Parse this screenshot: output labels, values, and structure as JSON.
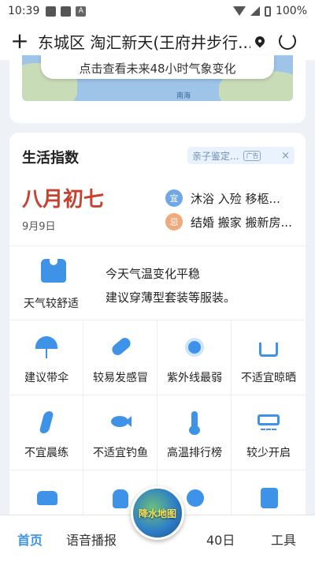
{
  "status_bar": {
    "time": "10:39",
    "notif_a": "A",
    "battery": "100%"
  },
  "header": {
    "location": "东城区 淘汇新天(王府井步行..."
  },
  "map": {
    "forecast_pill": "点击查看未来48小时气象变化",
    "sea_label": "南海"
  },
  "life_index": {
    "title": "生活指数",
    "ad": {
      "text": "亲子鉴定...",
      "tag": "广告",
      "close": "×"
    },
    "almanac": {
      "lunar_date": "八月初七",
      "solar_date": "9月9日",
      "yi_badge": "宜",
      "yi_items": "沐浴 入殓 移柩...",
      "ji_badge": "忌",
      "ji_items": "结婚 搬家 搬新房..."
    },
    "comfort": {
      "label": "天气较舒适",
      "advice_line1": "今天气温变化平稳",
      "advice_line2": "建议穿薄型套装等服装。"
    },
    "grid": [
      {
        "label": "建议带伞",
        "icon": "umbrella-icon"
      },
      {
        "label": "较易发感冒",
        "icon": "pill-icon"
      },
      {
        "label": "紫外线最弱",
        "icon": "sun-icon"
      },
      {
        "label": "不适宜晾晒",
        "icon": "hanger-icon"
      },
      {
        "label": "不宜晨练",
        "icon": "runner-icon"
      },
      {
        "label": "不适宜钓鱼",
        "icon": "fish-icon"
      },
      {
        "label": "高温排行榜",
        "icon": "thermometer-icon"
      },
      {
        "label": "较少开启",
        "icon": "air-conditioner-icon"
      },
      {
        "label": "",
        "icon": "car-icon"
      },
      {
        "label": "",
        "icon": "bag-icon"
      },
      {
        "label": "",
        "icon": "virus-icon"
      },
      {
        "label": "",
        "icon": "coupon-icon"
      }
    ]
  },
  "bottom_nav": {
    "items": [
      "首页",
      "语音播报",
      "40日",
      "工具"
    ],
    "active": "首页",
    "center_button": "降水地图"
  },
  "colors": {
    "accent": "#3e93e8",
    "lunar_red": "#c8402f",
    "yi": "#6fa7e8",
    "ji": "#f0a97a"
  }
}
